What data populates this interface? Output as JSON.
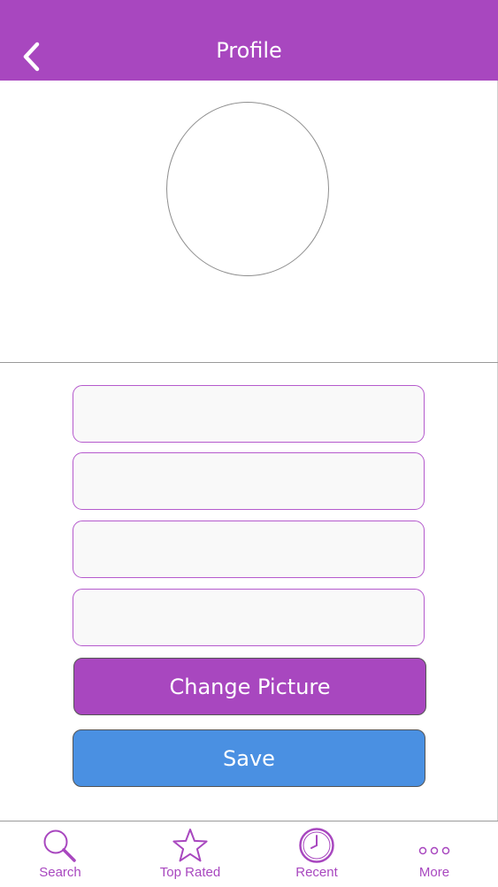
{
  "header": {
    "title": "Profile",
    "back_icon": "chevron-left-icon"
  },
  "colors": {
    "accent": "#a847bf",
    "save_button": "#4a90e2",
    "field_border": "#b55acd"
  },
  "form": {
    "fields": [
      {
        "value": "",
        "placeholder": ""
      },
      {
        "value": "",
        "placeholder": ""
      },
      {
        "value": "",
        "placeholder": ""
      },
      {
        "value": "",
        "placeholder": ""
      }
    ],
    "change_picture_label": "Change Picture",
    "save_label": "Save"
  },
  "tabbar": {
    "items": [
      {
        "label": "Search",
        "icon": "search-icon"
      },
      {
        "label": "Top Rated",
        "icon": "star-icon"
      },
      {
        "label": "Recent",
        "icon": "clock-icon"
      },
      {
        "label": "More",
        "icon": "more-icon"
      }
    ]
  }
}
